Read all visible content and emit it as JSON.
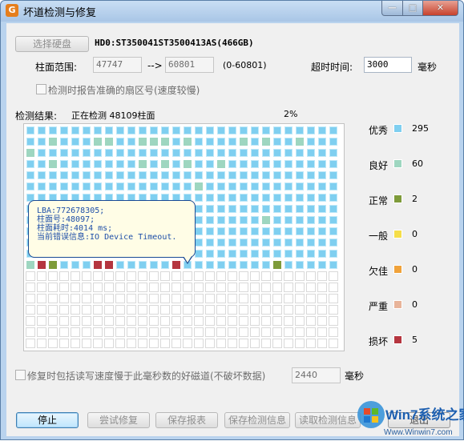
{
  "window": {
    "title": "坏道检测与修复"
  },
  "disk": {
    "select_button": "选择硬盘",
    "name": "HD0:ST350041ST3500413AS(466GB)"
  },
  "range": {
    "label": "柱面范围:",
    "from": "47747",
    "arrow": "-->",
    "to": "60801",
    "total": "(0-60801)",
    "timeout_label": "超时时间:",
    "timeout_value": "3000",
    "timeout_unit": "毫秒"
  },
  "options": {
    "report_exact_sector": "检测时报告准确的扇区号(速度较慢)",
    "repair_slow": "修复时包括读写速度慢于此毫秒数的好磁道(不破坏数据)",
    "repair_threshold": "2440",
    "repair_unit": "毫秒"
  },
  "result": {
    "label": "检测结果:",
    "status": "正在检测 48109柱面",
    "percent": "2%"
  },
  "tooltip": {
    "lines": [
      "LBA:772678305;",
      "柱面号:48097;",
      "柱面耗时:4014 ms;",
      "当前错误信息:IO Device Timeout."
    ]
  },
  "legend": [
    {
      "name": "优秀",
      "color": "#7fcff0",
      "count": "295"
    },
    {
      "name": "良好",
      "color": "#9ed6c0",
      "count": "60"
    },
    {
      "name": "正常",
      "color": "#7e9b3a",
      "count": "2"
    },
    {
      "name": "一般",
      "color": "#f5de4a",
      "count": "0"
    },
    {
      "name": "欠佳",
      "color": "#f0a23a",
      "count": "0"
    },
    {
      "name": "严重",
      "color": "#e8b49a",
      "count": "0"
    },
    {
      "name": "损坏",
      "color": "#b5353f",
      "count": "5"
    }
  ],
  "grid_rows": [
    "0000000000000000000000000000",
    "0010001100111010000101001000",
    "1000000000000000000000000000",
    "0010000000101010010000000000",
    "0000000000000000000000000000",
    "0000000000000001000000000000",
    "0000000000000000000000000000",
    "0000000000000000000000000000",
    "0000000000000000000001000000",
    "0000000000000000000000000000",
    "0000000000000000000000000000",
    "0060000000000000000000000000",
    "1620006600000600000000200000",
    "----------------------------",
    "----------------------------",
    "----------------------------",
    "----------------------------",
    "----------------------------",
    "----------------------------",
    "----------------------------"
  ],
  "buttons": {
    "stop": "停止",
    "try_repair": "尝试修复",
    "save_report": "保存报表",
    "save_result": "保存检测信息",
    "read_result": "读取检测信息",
    "exit": "退出"
  },
  "watermark": {
    "text": "Win7系统之家",
    "url": "Www.Winwin7.com"
  }
}
